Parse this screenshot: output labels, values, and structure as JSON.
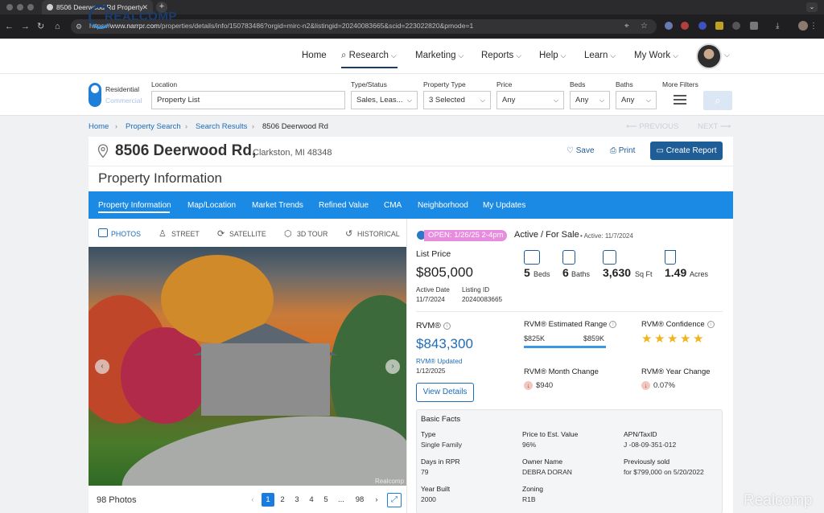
{
  "browser": {
    "tab_title": "8506 Deerwood Rd Property",
    "new_tab": "+",
    "url_prefix": "https://",
    "url_domain": "www.narrpr.com",
    "url_path": "/properties/details/info/150783486?orgid=mirc-n2&listingid=20240083665&scid=223022820&pmode=1"
  },
  "header": {
    "logo_text": "REALCOMP",
    "logo_tagline": "Data-driven. Results-focused. MLS",
    "nav": [
      {
        "label": "Home"
      },
      {
        "label": "Research"
      },
      {
        "label": "Marketing"
      },
      {
        "label": "Reports"
      },
      {
        "label": "Help"
      },
      {
        "label": "Learn"
      },
      {
        "label": "My Work"
      }
    ]
  },
  "search": {
    "toggle_residential": "Residential",
    "toggle_commercial": "Commercial",
    "location_label": "Location",
    "location_value": "Property List",
    "type_label": "Type/Status",
    "type_value": "Sales, Leas...",
    "ptype_label": "Property Type",
    "ptype_value": "3 Selected",
    "price_label": "Price",
    "price_value": "Any",
    "beds_label": "Beds",
    "beds_value": "Any",
    "baths_label": "Baths",
    "baths_value": "Any",
    "more_label": "More Filters"
  },
  "breadcrumb": [
    "Home",
    "Property Search",
    "Search Results",
    "8506 Deerwood Rd"
  ],
  "pager_nav": {
    "previous": "PREVIOUS",
    "next": "NEXT"
  },
  "property": {
    "address": "8506 Deerwood Rd,",
    "city": "Clarkston, MI 48348",
    "save_label": "Save",
    "print_label": "Print",
    "create_report_label": "Create Report",
    "section_title": "Property Information"
  },
  "tabs": [
    "Property Information",
    "Map/Location",
    "Market Trends",
    "Refined Value",
    "CMA",
    "Neighborhood",
    "My Updates"
  ],
  "photo_tabs": [
    "PHOTOS",
    "STREET",
    "SATELLITE",
    "3D TOUR",
    "HISTORICAL"
  ],
  "photos": {
    "count_label": "98 Photos",
    "pages": [
      "1",
      "2",
      "3",
      "4",
      "5",
      "...",
      "98"
    ],
    "current_page": "1",
    "watermark": "Realcomp"
  },
  "listing": {
    "open_house": "OPEN: 1/26/25 2-4pm",
    "status": "Active / For Sale",
    "status_date": "Active: 11/7/2024",
    "list_price_label": "List Price",
    "list_price": "$805,000",
    "active_date_label": "Active Date",
    "active_date": "11/7/2024",
    "listing_id_label": "Listing ID",
    "listing_id": "20240083665",
    "beds": "5",
    "beds_unit": "Beds",
    "baths": "6",
    "baths_unit": "Baths",
    "sqft": "3,630",
    "sqft_unit": "Sq Ft",
    "acres": "1.49",
    "acres_unit": "Acres"
  },
  "rvm": {
    "label": "RVM®",
    "value": "$843,300",
    "updated_label": "RVM® Updated",
    "updated": "1/12/2025",
    "range_label": "RVM® Estimated Range",
    "range_low": "$825K",
    "range_high": "$859K",
    "confidence_label": "RVM® Confidence",
    "confidence_stars": 5,
    "month_change_label": "RVM® Month Change",
    "month_change": "$940",
    "year_change_label": "RVM® Year Change",
    "year_change": "0.07%",
    "view_details": "View Details"
  },
  "facts": {
    "title": "Basic Facts",
    "items": [
      {
        "label": "Type",
        "value": "Single Family"
      },
      {
        "label": "Price to Est. Value",
        "value": "96%"
      },
      {
        "label": "APN/TaxID",
        "value": "J -08-09-351-012"
      },
      {
        "label": "Days in RPR",
        "value": "79"
      },
      {
        "label": "Owner Name",
        "value": "DEBRA DORAN"
      },
      {
        "label": "Previously sold",
        "value": "for $799,000 on 5/20/2022"
      },
      {
        "label": "Year Built",
        "value": "2000"
      },
      {
        "label": "Zoning",
        "value": "R1B"
      }
    ]
  },
  "watermark": "Realcomp",
  "colors": {
    "primary_blue": "#1b8ae4",
    "dark_blue": "#1f5d96",
    "open_badge": "#e88ce0",
    "star": "#f2b418"
  }
}
